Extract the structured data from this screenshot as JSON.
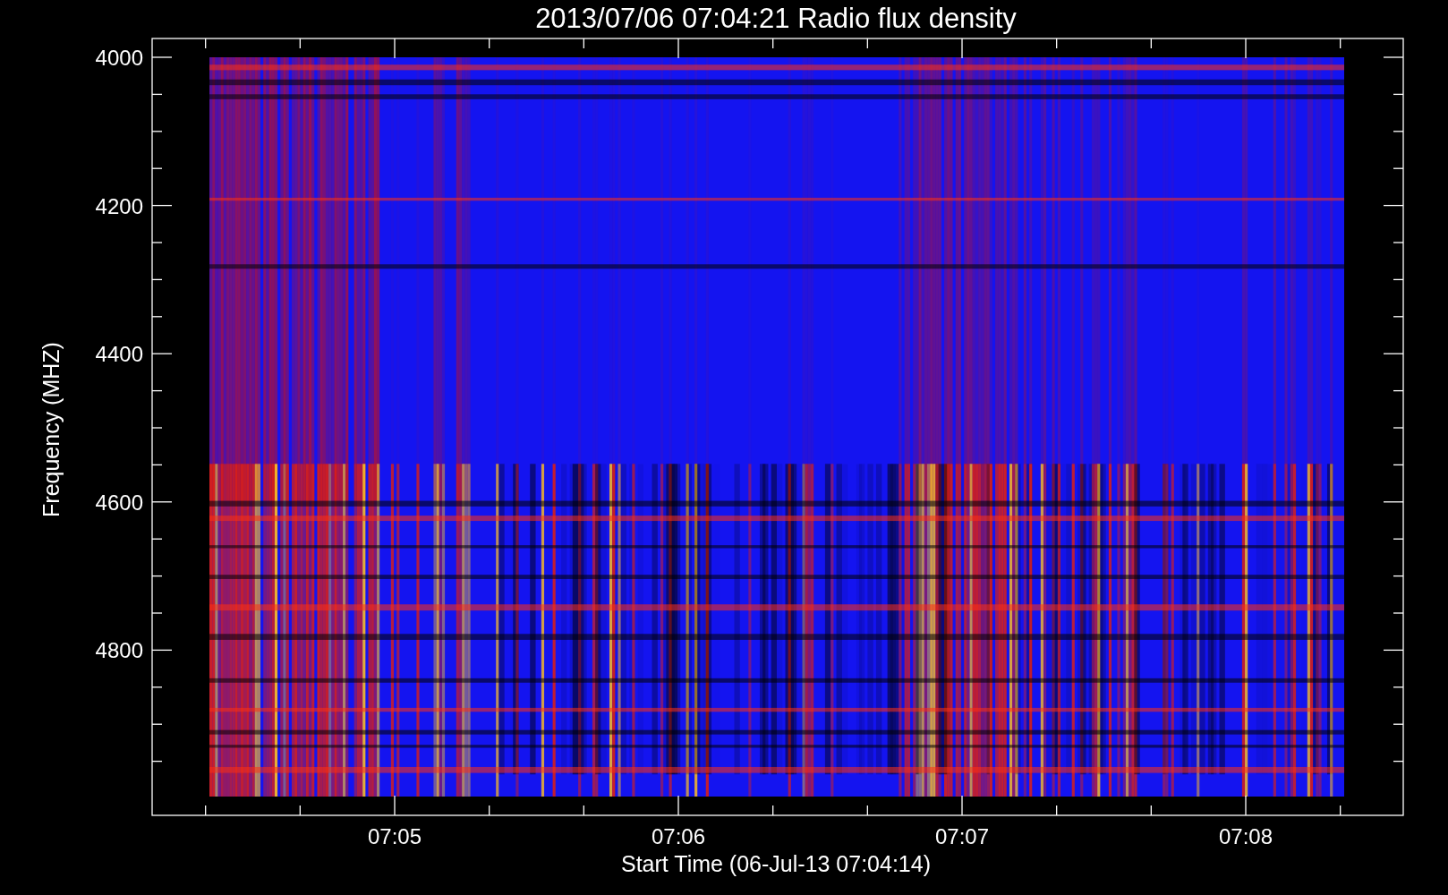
{
  "title": "2013/07/06 07:04:21 Radio flux density",
  "y_axis": {
    "label": "Frequency (MHZ)",
    "ticks": [
      "4000",
      "4200",
      "4400",
      "4600",
      "4800"
    ]
  },
  "x_axis": {
    "label": "Start Time (06-Jul-13 07:04:14)",
    "ticks": [
      "07:05",
      "07:06",
      "07:07",
      "07:08"
    ]
  }
}
